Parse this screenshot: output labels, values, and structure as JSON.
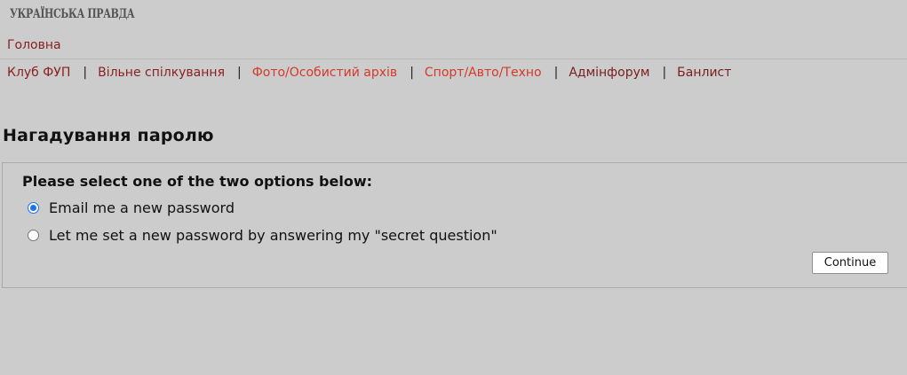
{
  "header": {
    "masthead": "УКРАЇНСЬКА ПРАВДА",
    "home_link": "Головна"
  },
  "nav": {
    "items": [
      {
        "label": "Клуб ФУП",
        "color": "#8a1f1f"
      },
      {
        "label": "Вільне спілкування",
        "color": "#8a1f1f"
      },
      {
        "label": "Фото/Особистий архів",
        "color": "#d23a2a"
      },
      {
        "label": "Спорт/Авто/Техно",
        "color": "#d23a2a"
      },
      {
        "label": "Адмінфорум",
        "color": "#7a1d1d"
      },
      {
        "label": "Банлист",
        "color": "#7a1d1d"
      }
    ],
    "separator": "|"
  },
  "page": {
    "title": "Нагадування паролю"
  },
  "form": {
    "prompt": "Please select one of the two options below:",
    "options": [
      {
        "label": "Email me a new password",
        "selected": true
      },
      {
        "label": "Let me set a new password by answering my \"secret question\"",
        "selected": false
      }
    ],
    "continue_label": "Continue"
  },
  "colors": {
    "background": "#cccccc",
    "link": "#8a1f1f",
    "link_highlight": "#d23a2a",
    "radio_selected": "#1a73e8"
  }
}
